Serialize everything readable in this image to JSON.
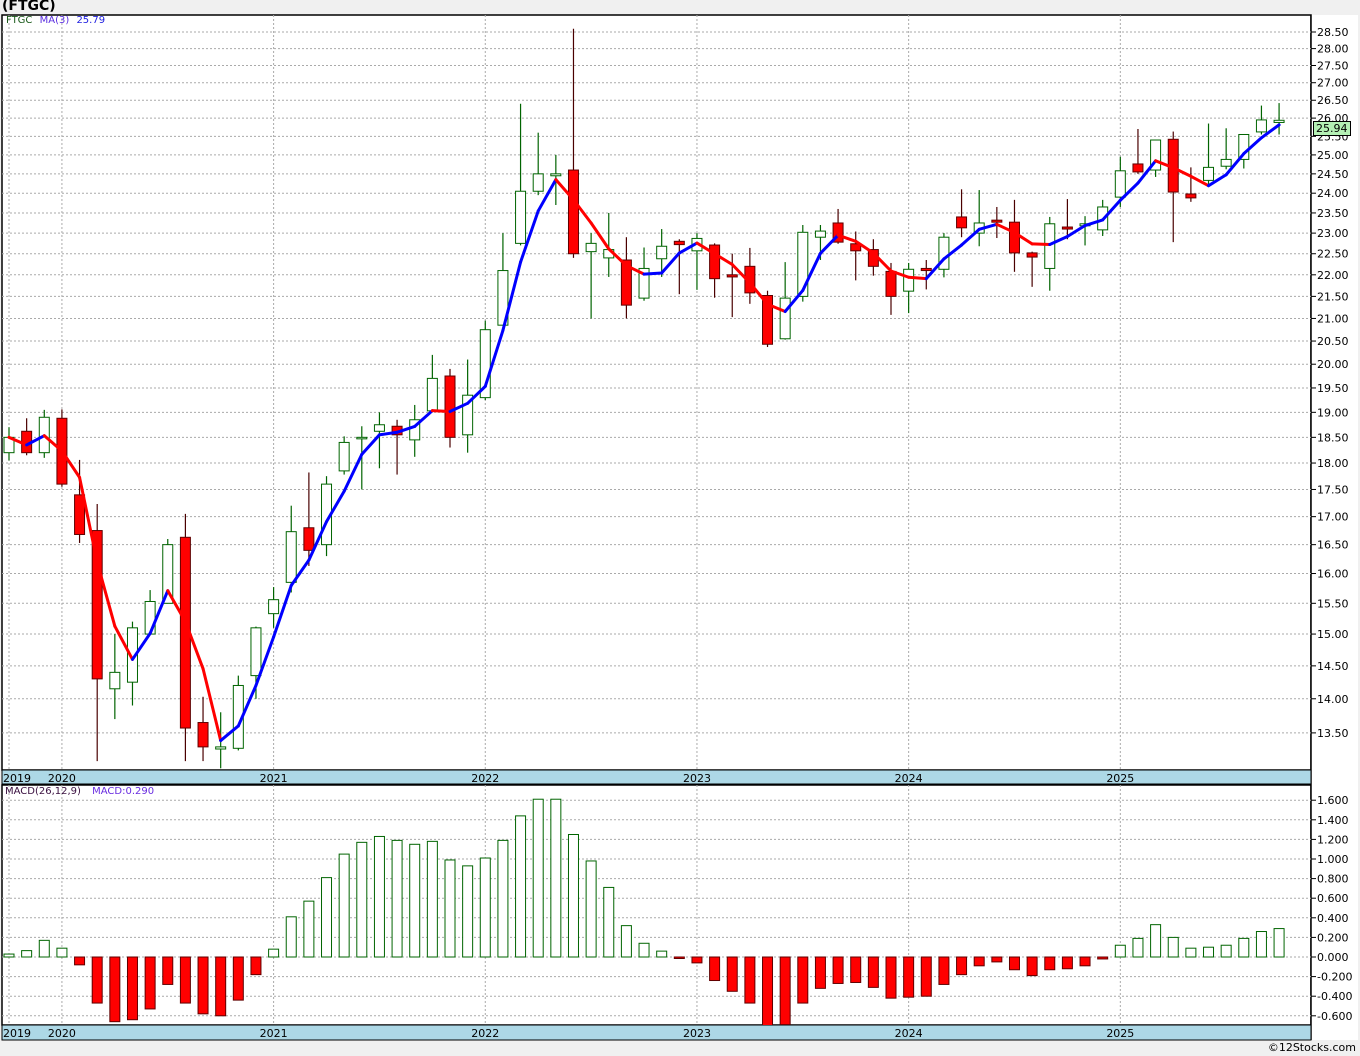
{
  "title": "(FTGC)",
  "legend": {
    "symbol": "FTGC",
    "ma_label": "MA(3)",
    "ma_value": "25.79"
  },
  "macd_legend": {
    "label": "MACD(26,12,9)",
    "value": "MACD:0.290"
  },
  "last_price": "25.94",
  "copyright": "©12Stocks.com",
  "colors": {
    "up": "#006400",
    "down": "#ff0000",
    "ma_up": "#0000ff",
    "ma_down": "#ff0000",
    "axis_band": "#add8e6",
    "last_price_box": "#b4f0b4"
  },
  "chart_data": [
    {
      "type": "candlestick",
      "interval": "monthly",
      "yscale": "log",
      "ylim": [
        13.0,
        28.7
      ],
      "grid": true,
      "overlay": {
        "name": "MA(3)",
        "type": "simple moving average",
        "period": 3
      },
      "yticks": [
        "13.50",
        "14.00",
        "14.50",
        "15.00",
        "15.50",
        "16.00",
        "16.50",
        "17.00",
        "17.50",
        "18.00",
        "18.50",
        "19.00",
        "19.50",
        "20.00",
        "20.50",
        "21.00",
        "21.50",
        "22.00",
        "22.50",
        "23.00",
        "23.50",
        "24.00",
        "24.50",
        "25.00",
        "25.50",
        "26.00",
        "26.50",
        "27.00",
        "27.50",
        "28.00",
        "28.50"
      ],
      "xticks": [
        {
          "label": "2019",
          "month": "2019-10"
        },
        {
          "label": "2020",
          "month": "2020-01"
        },
        {
          "label": "2021",
          "month": "2021-01"
        },
        {
          "label": "2022",
          "month": "2022-01"
        },
        {
          "label": "2023",
          "month": "2023-01"
        },
        {
          "label": "2024",
          "month": "2024-01"
        },
        {
          "label": "2025",
          "month": "2025-01"
        }
      ],
      "columns": [
        "month",
        "open",
        "high",
        "low",
        "close"
      ],
      "candles": [
        [
          "2019-10",
          18.2,
          18.7,
          18.05,
          18.5
        ],
        [
          "2019-11",
          18.62,
          18.88,
          18.15,
          18.2
        ],
        [
          "2019-12",
          18.2,
          19.05,
          18.1,
          18.9
        ],
        [
          "2020-01",
          18.88,
          19.06,
          17.55,
          17.6
        ],
        [
          "2020-02",
          17.4,
          18.06,
          16.53,
          16.68
        ],
        [
          "2020-03",
          16.75,
          17.23,
          13.1,
          14.3
        ],
        [
          "2020-04",
          14.15,
          15.0,
          13.7,
          14.4
        ],
        [
          "2020-05",
          14.25,
          15.2,
          13.9,
          15.1
        ],
        [
          "2020-06",
          15.0,
          15.72,
          15.0,
          15.53
        ],
        [
          "2020-07",
          15.5,
          16.6,
          15.5,
          16.5
        ],
        [
          "2020-08",
          16.63,
          17.05,
          13.1,
          13.57
        ],
        [
          "2020-09",
          13.65,
          14.03,
          13.1,
          13.3
        ],
        [
          "2020-10",
          13.27,
          13.8,
          13.0,
          13.3
        ],
        [
          "2020-11",
          13.28,
          14.35,
          13.25,
          14.2
        ],
        [
          "2020-12",
          14.35,
          15.12,
          14.0,
          15.1
        ],
        [
          "2021-01",
          15.33,
          15.77,
          15.1,
          15.56
        ],
        [
          "2021-02",
          15.85,
          17.2,
          15.68,
          16.73
        ],
        [
          "2021-03",
          16.8,
          17.82,
          16.13,
          16.4
        ],
        [
          "2021-04",
          16.5,
          17.75,
          16.3,
          17.6
        ],
        [
          "2021-05",
          17.85,
          18.52,
          17.78,
          18.4
        ],
        [
          "2021-06",
          18.48,
          18.72,
          17.5,
          18.5
        ],
        [
          "2021-07",
          18.62,
          19.0,
          17.9,
          18.75
        ],
        [
          "2021-08",
          18.72,
          18.85,
          17.78,
          18.55
        ],
        [
          "2021-09",
          18.45,
          19.15,
          18.12,
          18.85
        ],
        [
          "2021-10",
          19.03,
          20.2,
          19.0,
          19.7
        ],
        [
          "2021-11",
          19.75,
          19.9,
          18.3,
          18.5
        ],
        [
          "2021-12",
          18.55,
          20.1,
          18.2,
          19.35
        ],
        [
          "2022-01",
          19.3,
          20.95,
          19.25,
          20.75
        ],
        [
          "2022-02",
          20.85,
          23.0,
          20.85,
          22.1
        ],
        [
          "2022-03",
          22.75,
          26.4,
          22.7,
          24.05
        ],
        [
          "2022-04",
          24.05,
          25.6,
          23.95,
          24.5
        ],
        [
          "2022-05",
          24.45,
          25.0,
          23.7,
          24.5
        ],
        [
          "2022-06",
          24.6,
          28.6,
          22.4,
          22.5
        ],
        [
          "2022-07",
          22.55,
          23.0,
          21.0,
          22.75
        ],
        [
          "2022-08",
          22.4,
          23.5,
          21.95,
          22.6
        ],
        [
          "2022-09",
          22.35,
          22.9,
          21.0,
          21.3
        ],
        [
          "2022-10",
          21.46,
          22.65,
          21.4,
          22.15
        ],
        [
          "2022-11",
          22.38,
          23.1,
          21.95,
          22.68
        ],
        [
          "2022-12",
          22.8,
          22.85,
          21.55,
          22.72
        ],
        [
          "2023-01",
          22.57,
          23.0,
          21.65,
          22.87
        ],
        [
          "2023-02",
          22.71,
          22.75,
          21.47,
          21.91
        ],
        [
          "2023-03",
          22.0,
          22.5,
          21.03,
          21.95
        ],
        [
          "2023-04",
          22.2,
          22.64,
          21.33,
          21.58
        ],
        [
          "2023-05",
          21.52,
          21.63,
          20.37,
          20.43
        ],
        [
          "2023-06",
          20.55,
          22.3,
          20.53,
          21.46
        ],
        [
          "2023-07",
          21.5,
          23.2,
          21.38,
          23.02
        ],
        [
          "2023-08",
          22.9,
          23.2,
          22.35,
          23.05
        ],
        [
          "2023-09",
          23.25,
          23.6,
          22.74,
          22.78
        ],
        [
          "2023-10",
          22.74,
          23.04,
          21.87,
          22.57
        ],
        [
          "2023-11",
          22.6,
          22.85,
          21.98,
          22.2
        ],
        [
          "2023-12",
          22.08,
          22.28,
          21.08,
          21.5
        ],
        [
          "2024-01",
          21.62,
          22.28,
          21.12,
          22.13
        ],
        [
          "2024-02",
          22.15,
          22.35,
          21.66,
          22.1
        ],
        [
          "2024-03",
          22.13,
          23.0,
          21.94,
          22.9
        ],
        [
          "2024-04",
          23.4,
          24.1,
          22.9,
          23.13
        ],
        [
          "2024-05",
          23.0,
          24.08,
          22.68,
          23.25
        ],
        [
          "2024-06",
          23.32,
          23.65,
          22.88,
          23.27
        ],
        [
          "2024-07",
          23.27,
          23.83,
          22.07,
          22.52
        ],
        [
          "2024-08",
          22.52,
          22.55,
          21.72,
          22.42
        ],
        [
          "2024-09",
          22.15,
          23.4,
          21.63,
          23.23
        ],
        [
          "2024-10",
          23.15,
          23.85,
          22.85,
          23.1
        ],
        [
          "2024-11",
          23.18,
          23.42,
          22.7,
          23.23
        ],
        [
          "2024-12",
          23.08,
          23.83,
          22.93,
          23.65
        ],
        [
          "2025-01",
          23.9,
          24.95,
          23.65,
          24.58
        ],
        [
          "2025-02",
          24.76,
          25.7,
          24.5,
          24.55
        ],
        [
          "2025-03",
          24.6,
          25.4,
          24.42,
          25.4
        ],
        [
          "2025-04",
          25.42,
          25.63,
          22.78,
          24.03
        ],
        [
          "2025-05",
          23.98,
          24.67,
          23.78,
          23.88
        ],
        [
          "2025-06",
          24.33,
          25.85,
          24.17,
          24.67
        ],
        [
          "2025-07",
          24.7,
          25.72,
          24.62,
          24.88
        ],
        [
          "2025-08",
          24.88,
          25.55,
          24.64,
          25.55
        ],
        [
          "2025-09",
          25.62,
          26.35,
          25.55,
          25.95
        ],
        [
          "2025-10",
          25.88,
          26.42,
          25.55,
          25.94
        ]
      ]
    },
    {
      "type": "bar",
      "name": "MACD(26,12,9)",
      "ylim": [
        -0.7,
        1.7
      ],
      "grid": true,
      "yticks": [
        "-0.600",
        "-0.400",
        "-0.200",
        "0.000",
        "0.200",
        "0.400",
        "0.600",
        "0.800",
        "1.000",
        "1.200",
        "1.400",
        "1.600"
      ],
      "values": [
        0.03,
        0.065,
        0.17,
        0.09,
        -0.08,
        -0.47,
        -0.66,
        -0.64,
        -0.53,
        -0.28,
        -0.47,
        -0.58,
        -0.6,
        -0.44,
        -0.18,
        0.08,
        0.41,
        0.57,
        0.81,
        1.05,
        1.17,
        1.23,
        1.19,
        1.15,
        1.18,
        0.99,
        0.93,
        1.01,
        1.19,
        1.44,
        1.61,
        1.61,
        1.25,
        0.98,
        0.71,
        0.32,
        0.14,
        0.06,
        -0.01,
        -0.06,
        -0.24,
        -0.35,
        -0.47,
        -0.72,
        -0.69,
        -0.47,
        -0.32,
        -0.27,
        -0.26,
        -0.31,
        -0.42,
        -0.41,
        -0.4,
        -0.28,
        -0.18,
        -0.09,
        -0.05,
        -0.13,
        -0.19,
        -0.13,
        -0.12,
        -0.09,
        -0.02,
        0.12,
        0.19,
        0.33,
        0.2,
        0.09,
        0.1,
        0.12,
        0.19,
        0.26,
        0.29
      ]
    }
  ]
}
